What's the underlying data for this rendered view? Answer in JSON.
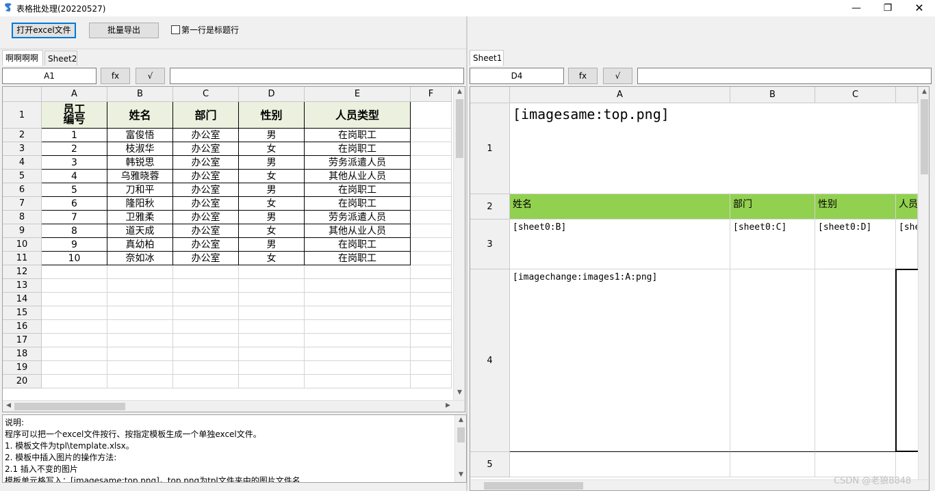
{
  "window": {
    "title": "表格批处理(20220527)",
    "minimize": "—",
    "maximize": "❐",
    "close": "✕"
  },
  "toolbar": {
    "open_label": "打开excel文件",
    "export_label": "批量导出",
    "header_checkbox_label": "第一行是标题行",
    "header_checkbox_checked": false
  },
  "left": {
    "tabs": [
      "啊啊啊啊",
      "Sheet2"
    ],
    "active_tab": 0,
    "namebox": "A1",
    "fx_label": "fx",
    "check_label": "√",
    "formula": "",
    "columns": [
      "A",
      "B",
      "C",
      "D",
      "E",
      "F"
    ],
    "rows": [
      "1",
      "2",
      "3",
      "4",
      "5",
      "6",
      "7",
      "8",
      "9",
      "10",
      "11",
      "12",
      "13",
      "14",
      "15",
      "16",
      "17",
      "18",
      "19",
      "20"
    ],
    "header_row": [
      "员工\n编号",
      "姓名",
      "部门",
      "性别",
      "人员类型"
    ],
    "data": [
      [
        "1",
        "富俊悟",
        "办公室",
        "男",
        "在岗职工"
      ],
      [
        "2",
        "枝淑华",
        "办公室",
        "女",
        "在岗职工"
      ],
      [
        "3",
        "韩锐思",
        "办公室",
        "男",
        "劳务派遣人员"
      ],
      [
        "4",
        "乌雅晓蓉",
        "办公室",
        "女",
        "其他从业人员"
      ],
      [
        "5",
        "刀和平",
        "办公室",
        "男",
        "在岗职工"
      ],
      [
        "6",
        "隆阳秋",
        "办公室",
        "女",
        "在岗职工"
      ],
      [
        "7",
        "卫雅柔",
        "办公室",
        "男",
        "劳务派遣人员"
      ],
      [
        "8",
        "道天成",
        "办公室",
        "女",
        "其他从业人员"
      ],
      [
        "9",
        "真幼柏",
        "办公室",
        "男",
        "在岗职工"
      ],
      [
        "10",
        "奈如冰",
        "办公室",
        "女",
        "在岗职工"
      ]
    ]
  },
  "right": {
    "tabs": [
      "Sheet1"
    ],
    "namebox": "D4",
    "fx_label": "fx",
    "check_label": "√",
    "formula": "",
    "columns": [
      "A",
      "B",
      "C"
    ],
    "rows": [
      "1",
      "2",
      "3",
      "4",
      "5"
    ],
    "cells": {
      "a1": "[imagesame:top.png]",
      "a2": "姓名",
      "b2": "部门",
      "c2": "性别",
      "d2": "人员",
      "a3": "[sheet0:B]",
      "b3": "[sheet0:C]",
      "c3": "[sheet0:D]",
      "d3": "[she",
      "a4": "[imagechange:images1:A:png]"
    }
  },
  "notes": {
    "lines": [
      "说明:",
      "程序可以把一个excel文件按行、按指定模板生成一个单独excel文件。",
      "1. 模板文件为tpl\\template.xlsx。",
      "2. 模板中插入图片的操作方法:",
      "2.1 插入不变的图片",
      "模板单元格写入：[imagesame:top.png]，top.png为tpl文件夹中的图片文件名"
    ]
  },
  "watermark": "CSDN @老狼8848",
  "colors": {
    "header_fill": "#ebf1de",
    "green_fill": "#92d050",
    "accent": "#0078d7"
  }
}
